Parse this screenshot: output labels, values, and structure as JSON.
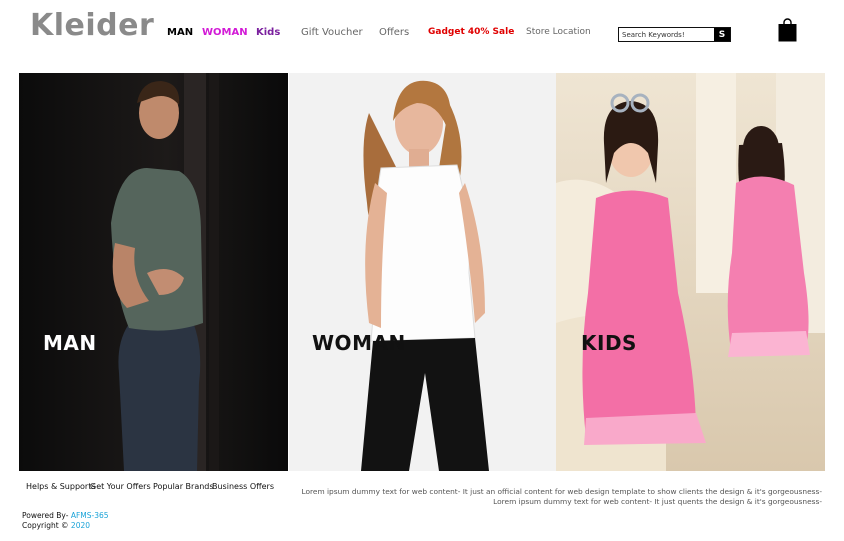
{
  "brand": {
    "logo_text": "Kleider"
  },
  "nav": {
    "items": [
      {
        "label": "MAN",
        "color": "#000000"
      },
      {
        "label": "WOMAN",
        "color": "#d21ad6"
      },
      {
        "label": "Kids",
        "color": "#7a1f9e"
      },
      {
        "label": "Gift Voucher",
        "color": "#666666"
      },
      {
        "label": "Offers",
        "color": "#666666"
      },
      {
        "label": "Gadget 40% Sale",
        "color": "#e00000"
      },
      {
        "label": "Store Location",
        "color": "#666666"
      }
    ]
  },
  "search": {
    "placeholder": "Search Keywords!",
    "button_label": "S"
  },
  "cart": {
    "icon": "shopping-bag-icon"
  },
  "categories": [
    {
      "label": "MAN",
      "label_color": "#ffffff",
      "background": "#121212"
    },
    {
      "label": "WOMAN",
      "label_color": "#111111",
      "background": "#f1f1f1"
    },
    {
      "label": "KIDS",
      "label_color": "#111111",
      "background": "#e3d4bc"
    }
  ],
  "footer": {
    "links": [
      "Helps & Supports",
      "Get Your Offers",
      "Popular Brands",
      "Business Offers"
    ],
    "description_1": "Lorem ipsum dummy text for web content- It just an official content for web design template to show clients the design & it's gorgeousness-",
    "description_2": "Lorem ipsum dummy text for web content- It just quents the design & it's gorgeousness-",
    "powered_prefix": "Powered By-",
    "powered_name": "AFMS-365",
    "copyright_prefix": "Copyright ©",
    "copyright_year": "2020"
  }
}
